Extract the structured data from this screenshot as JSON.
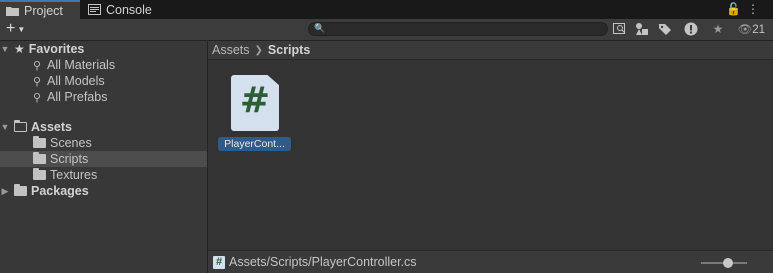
{
  "tabs": [
    {
      "label": "Project",
      "icon": "folder-icon",
      "active": true
    },
    {
      "label": "Console",
      "icon": "console-icon",
      "active": false
    }
  ],
  "toolbar": {
    "add_label": "+",
    "search": {
      "value": "",
      "placeholder": ""
    },
    "visibility_count": "21"
  },
  "tree": {
    "favorites": {
      "label": "Favorites",
      "items": [
        "All Materials",
        "All Models",
        "All Prefabs"
      ]
    },
    "assets": {
      "label": "Assets",
      "children": [
        {
          "label": "Scenes",
          "selected": false
        },
        {
          "label": "Scripts",
          "selected": true
        },
        {
          "label": "Textures",
          "selected": false
        }
      ]
    },
    "packages": {
      "label": "Packages"
    }
  },
  "breadcrumb": {
    "root": "Assets",
    "current": "Scripts"
  },
  "assets_grid": [
    {
      "label": "PlayerCont...",
      "icon": "csharp-script-icon",
      "glyph": "#",
      "selected": true
    }
  ],
  "status": {
    "path": "Assets/Scripts/PlayerController.cs",
    "icon_glyph": "#"
  },
  "zoom": {
    "value": 0.6
  },
  "colors": {
    "accent": "#3a79bb",
    "selection": "#2e5c8a",
    "script_green": "#2c5d33"
  }
}
